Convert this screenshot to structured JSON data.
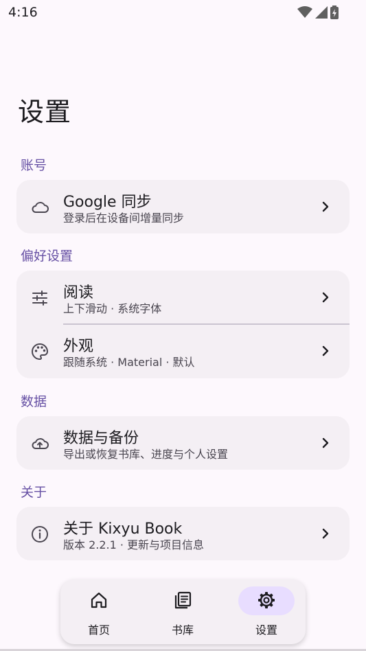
{
  "status_bar": {
    "time": "4:16"
  },
  "page": {
    "title": "设置"
  },
  "sections": {
    "account": {
      "label": "账号",
      "items": [
        {
          "title": "Google 同步",
          "subtitle": "登录后在设备间增量同步",
          "icon": "cloud-icon"
        }
      ]
    },
    "preferences": {
      "label": "偏好设置",
      "items": [
        {
          "title": "阅读",
          "subtitle": "上下滑动 · 系统字体",
          "icon": "tune-sliders-icon"
        },
        {
          "title": "外观",
          "subtitle": "跟随系统 · Material · 默认",
          "icon": "palette-icon"
        }
      ]
    },
    "data": {
      "label": "数据",
      "items": [
        {
          "title": "数据与备份",
          "subtitle": "导出或恢复书库、进度与个人设置",
          "icon": "cloud-upload-icon"
        }
      ]
    },
    "about": {
      "label": "关于",
      "items": [
        {
          "title": "关于 Kixyu Book",
          "subtitle": "版本 2.2.1 · 更新与项目信息",
          "icon": "info-icon"
        }
      ]
    }
  },
  "bottom_nav": {
    "items": [
      {
        "label": "首页",
        "icon": "home-icon",
        "active": false
      },
      {
        "label": "书库",
        "icon": "library-icon",
        "active": false
      },
      {
        "label": "设置",
        "icon": "gear-icon",
        "active": true
      }
    ]
  },
  "colors": {
    "accent": "#6650a4",
    "background": "#fdf8fd",
    "card": "#f4eff4",
    "active_pill": "#e8ddff"
  }
}
